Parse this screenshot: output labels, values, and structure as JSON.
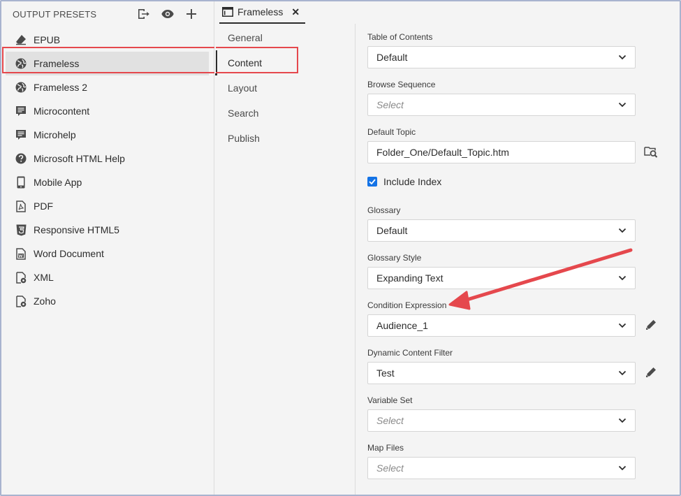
{
  "sidebar": {
    "title": "OUTPUT PRESETS",
    "tools": [
      {
        "name": "export-icon"
      },
      {
        "name": "eye-icon"
      },
      {
        "name": "plus-icon"
      }
    ],
    "items": [
      {
        "label": "EPUB",
        "icon": "eraser-icon"
      },
      {
        "label": "Frameless",
        "icon": "globe-icon",
        "active": true
      },
      {
        "label": "Frameless 2",
        "icon": "globe-icon"
      },
      {
        "label": "Microcontent",
        "icon": "document-lines-icon"
      },
      {
        "label": "Microhelp",
        "icon": "document-lines-icon"
      },
      {
        "label": "Microsoft HTML Help",
        "icon": "question-circle-icon"
      },
      {
        "label": "Mobile App",
        "icon": "mobile-phone-icon"
      },
      {
        "label": "PDF",
        "icon": "pdf-file-icon"
      },
      {
        "label": "Responsive HTML5",
        "icon": "html5-shield-icon"
      },
      {
        "label": "Word Document",
        "icon": "word-file-icon"
      },
      {
        "label": "XML",
        "icon": "file-gear-icon"
      },
      {
        "label": "Zoho",
        "icon": "file-gear-icon"
      }
    ]
  },
  "tab": {
    "label": "Frameless",
    "close": "✕",
    "icon": "window-icon"
  },
  "sections": [
    {
      "label": "General"
    },
    {
      "label": "Content",
      "active": true
    },
    {
      "label": "Layout"
    },
    {
      "label": "Search"
    },
    {
      "label": "Publish"
    }
  ],
  "form": {
    "toc": {
      "label": "Table of Contents",
      "value": "Default"
    },
    "browse": {
      "label": "Browse Sequence",
      "value": "Select"
    },
    "default_topic": {
      "label": "Default Topic",
      "value": "Folder_One/Default_Topic.htm"
    },
    "include_index": {
      "label": "Include Index",
      "checked": true
    },
    "glossary": {
      "label": "Glossary",
      "value": "Default"
    },
    "glossary_style": {
      "label": "Glossary Style",
      "value": "Expanding Text"
    },
    "condition": {
      "label": "Condition Expression",
      "value": "Audience_1"
    },
    "dynamic_filter": {
      "label": "Dynamic Content Filter",
      "value": "Test"
    },
    "variable_set": {
      "label": "Variable Set",
      "value": "Select"
    },
    "map_files": {
      "label": "Map Files",
      "value": "Select"
    }
  },
  "colors": {
    "accent": "#1473e6",
    "highlight": "#e5484d"
  }
}
